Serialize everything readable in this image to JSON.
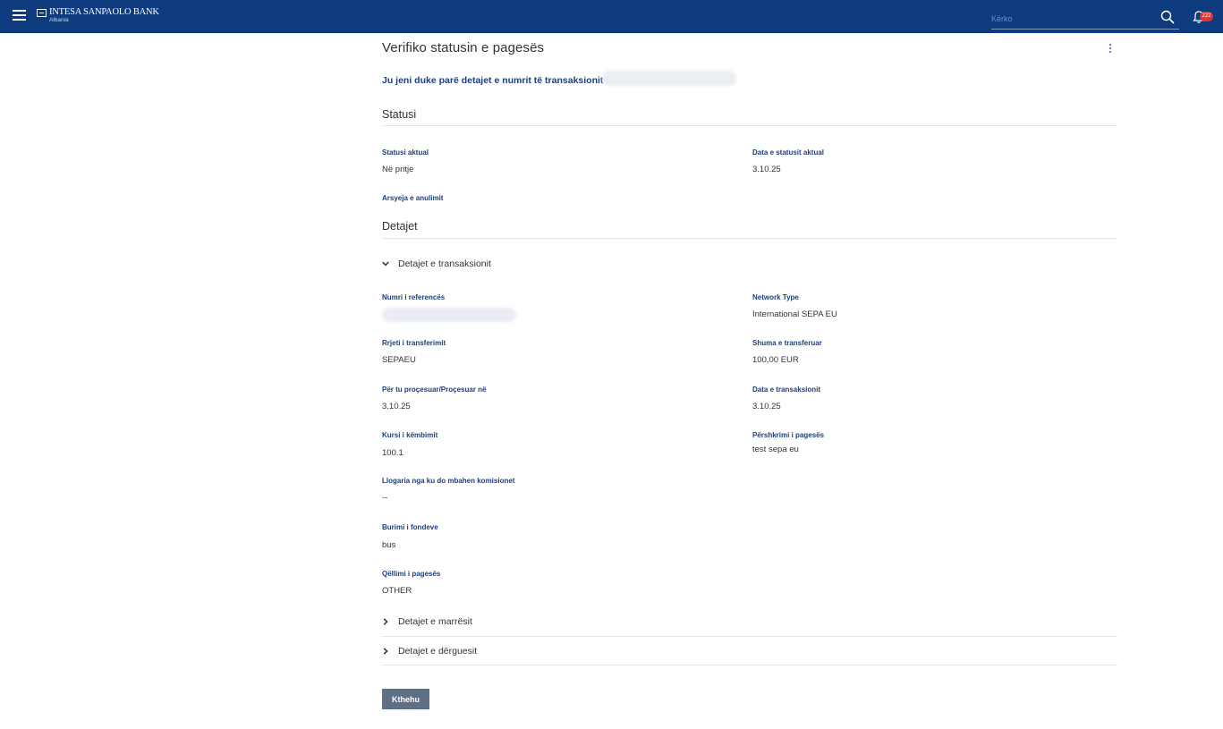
{
  "header": {
    "bank_name": "INTESA SANPAOLO BANK",
    "bank_region": "Albania",
    "search_placeholder": "Kërko",
    "notification_count": "222",
    "icons": [
      "menu-icon",
      "search-icon",
      "bell-icon"
    ]
  },
  "page": {
    "title": "Verifiko statusin e pagesës",
    "subtitle": "Ju jeni duke parë detajet e numrit të transaksionit"
  },
  "status_section": {
    "heading": "Statusi",
    "current_status_label": "Statusi aktual",
    "current_status_value": "Në pritje",
    "status_date_label": "Data e statusit aktual",
    "status_date_value": "3.10.25",
    "cancel_reason_label": "Arsyeja e anulimit"
  },
  "details_section": {
    "heading": "Detajet",
    "transaction_accordion": "Detajet e transaksionit",
    "fields": {
      "reference_number_label": "Numri i referencës",
      "network_type_label": "Network Type",
      "network_type_value": "International SEPA EU",
      "transfer_network_label": "Rrjeti i transferimit",
      "transfer_network_value": "SEPAEU",
      "transferred_amount_label": "Shuma e transferuar",
      "transferred_amount_value": "100,00 EUR",
      "processing_label": "Për tu proçesuar/Proçesuar në",
      "processing_value": "3.10.25",
      "transaction_date_label": "Data e transaksionit",
      "transaction_date_value": "3.10.25",
      "exchange_rate_label": "Kursi i këmbimit",
      "exchange_rate_value": "100.1",
      "payment_description_label": "Përshkrimi i pagesës",
      "payment_description_value": "test sepa eu",
      "fee_account_label": "Llogaria nga ku do mbahen komisionet",
      "fee_account_value": "--",
      "source_of_funds_label": "Burimi i fondeve",
      "source_of_funds_value": "bus",
      "payment_purpose_label": "Qëllimi i pagesës",
      "payment_purpose_value": "OTHER"
    },
    "receiver_accordion": "Detajet e marrësit",
    "sender_accordion": "Detajet e dërguesit"
  },
  "back_button": "Kthehu",
  "colors": {
    "header_bg": "#0d3b7d",
    "label_blue": "#1d3f7a",
    "badge_red": "#e2342b",
    "button_gray": "#5f6f86"
  }
}
